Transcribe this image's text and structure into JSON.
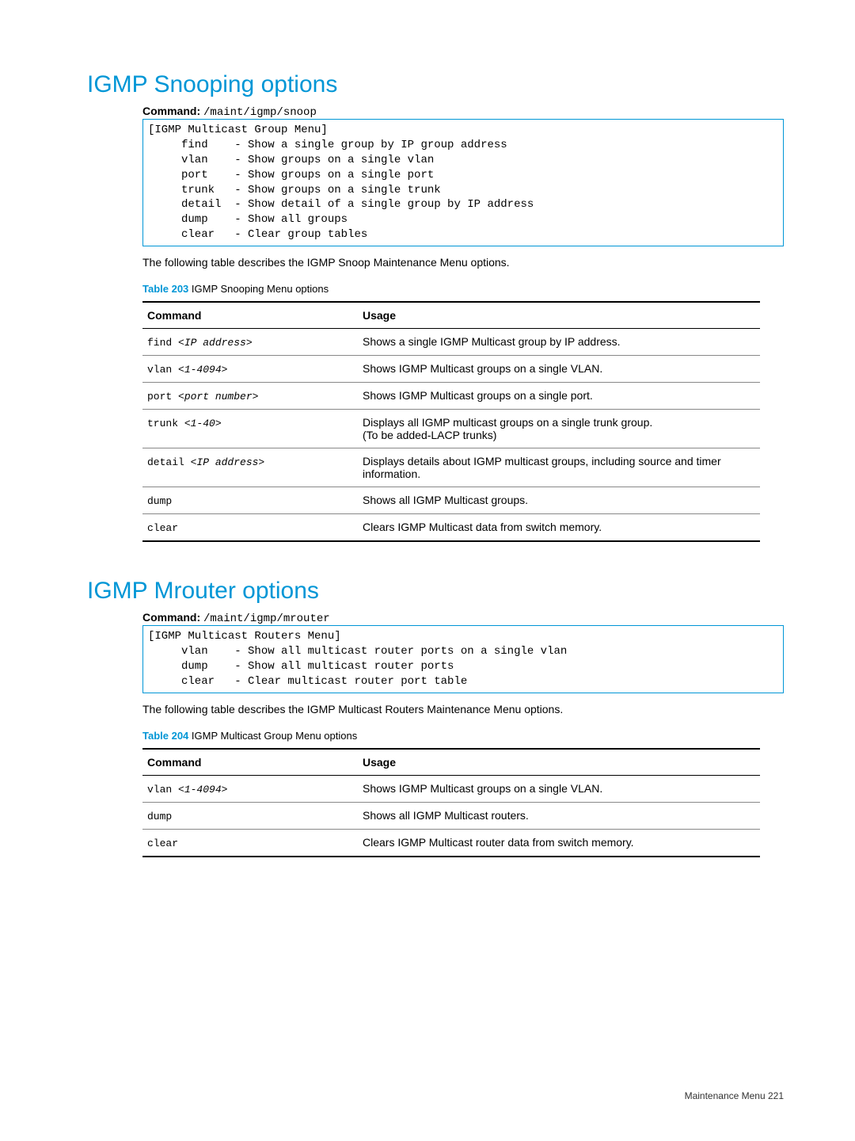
{
  "section1": {
    "title": "IGMP Snooping options",
    "command_label": "Command:",
    "command_path": "/maint/igmp/snoop",
    "menu_text": "[IGMP Multicast Group Menu]\n     find    - Show a single group by IP group address\n     vlan    - Show groups on a single vlan\n     port    - Show groups on a single port\n     trunk   - Show groups on a single trunk\n     detail  - Show detail of a single group by IP address\n     dump    - Show all groups\n     clear   - Clear group tables",
    "desc": "The following table describes the IGMP Snoop Maintenance Menu options.",
    "table_num": "Table 203",
    "table_title": " IGMP Snooping Menu options",
    "headers": {
      "c1": "Command",
      "c2": "Usage"
    },
    "rows": {
      "r0": {
        "cmd": "find ",
        "arg": "<IP address>",
        "usage": "Shows a single IGMP Multicast group by IP address."
      },
      "r1": {
        "cmd": "vlan ",
        "arg": "<1-4094>",
        "usage": "Shows IGMP Multicast groups on a single VLAN."
      },
      "r2": {
        "cmd": "port ",
        "arg": "<port number>",
        "usage": "Shows IGMP Multicast groups on a single port."
      },
      "r3": {
        "cmd": "trunk ",
        "arg": "<1-40>",
        "usage_l1": "Displays all IGMP multicast groups on a single trunk group.",
        "usage_l2": "(To be added-LACP trunks)"
      },
      "r4": {
        "cmd": "detail ",
        "arg": "<IP address>",
        "usage": "Displays details about IGMP multicast groups, including source and timer information."
      },
      "r5": {
        "cmd": "dump",
        "arg": "",
        "usage": "Shows all IGMP Multicast groups."
      },
      "r6": {
        "cmd": "clear",
        "arg": "",
        "usage": "Clears IGMP Multicast data from switch memory."
      }
    }
  },
  "section2": {
    "title": "IGMP Mrouter options",
    "command_label": "Command:",
    "command_path": "/maint/igmp/mrouter",
    "menu_text": "[IGMP Multicast Routers Menu]\n     vlan    - Show all multicast router ports on a single vlan\n     dump    - Show all multicast router ports\n     clear   - Clear multicast router port table",
    "desc": "The following table describes the IGMP Multicast Routers Maintenance Menu options.",
    "table_num": "Table 204",
    "table_title": " IGMP Multicast Group Menu options",
    "headers": {
      "c1": "Command",
      "c2": "Usage"
    },
    "rows": {
      "r0": {
        "cmd": "vlan ",
        "arg": "<1-4094>",
        "usage": "Shows IGMP Multicast groups on a single VLAN."
      },
      "r1": {
        "cmd": "dump",
        "arg": "",
        "usage": "Shows all IGMP Multicast routers."
      },
      "r2": {
        "cmd": "clear",
        "arg": "",
        "usage": "Clears IGMP Multicast router data from switch memory."
      }
    }
  },
  "footer": {
    "text": "Maintenance Menu   221"
  }
}
